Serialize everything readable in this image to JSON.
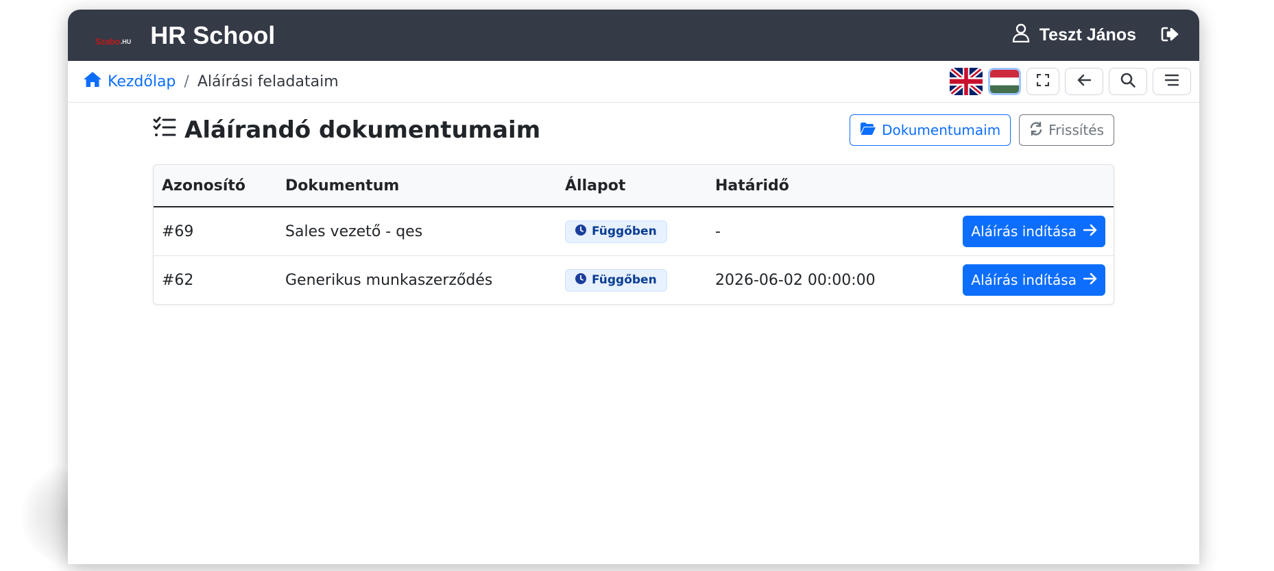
{
  "app": {
    "logo_mark": "Szabo",
    "logo_suffix": ".HU",
    "title": "HR School"
  },
  "user": {
    "name": "Teszt János",
    "icon": "user-icon",
    "logout_icon": "logout-icon"
  },
  "breadcrumb": {
    "home": "Kezdőlap",
    "separator": "/",
    "current": "Aláírási feladataim"
  },
  "toolbar": {
    "languages": [
      {
        "code": "en",
        "icon": "uk-flag-icon",
        "active": false
      },
      {
        "code": "hu",
        "icon": "hungary-flag-icon",
        "active": true
      }
    ],
    "buttons": [
      "fullscreen-icon",
      "arrow-left-icon",
      "search-icon",
      "menu-icon"
    ]
  },
  "page": {
    "title": "Aláírandó dokumentumaim",
    "my_documents_label": "Dokumentumaim",
    "refresh_label": "Frissítés"
  },
  "table": {
    "headers": {
      "id": "Azonosító",
      "document": "Dokumentum",
      "state": "Állapot",
      "deadline": "Határidő"
    },
    "rows": [
      {
        "id": "#69",
        "document": "Sales vezető - qes",
        "state": "Függőben",
        "deadline": "-",
        "action": "Aláírás indítása"
      },
      {
        "id": "#62",
        "document": "Generikus munkaszerződés",
        "state": "Függőben",
        "deadline": "2026-06-02 00:00:00",
        "action": "Aláírás indítása"
      }
    ]
  },
  "colors": {
    "topbar": "#343a46",
    "primary": "#0d6efd",
    "secondary": "#6c757d",
    "badge_bg": "#e7f1ff"
  }
}
